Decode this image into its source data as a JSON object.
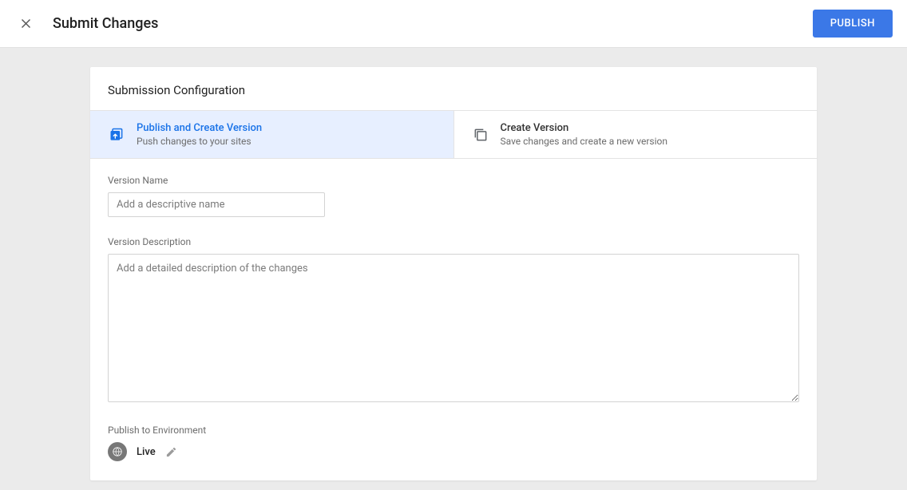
{
  "topbar": {
    "title": "Submit Changes",
    "publish_label": "PUBLISH"
  },
  "card": {
    "header": "Submission Configuration",
    "options": [
      {
        "title": "Publish and Create Version",
        "sub": "Push changes to your sites"
      },
      {
        "title": "Create Version",
        "sub": "Save changes and create a new version"
      }
    ],
    "version_name": {
      "label": "Version Name",
      "placeholder": "Add a descriptive name",
      "value": ""
    },
    "version_desc": {
      "label": "Version Description",
      "placeholder": "Add a detailed description of the changes",
      "value": ""
    },
    "env": {
      "label": "Publish to Environment",
      "name": "Live"
    }
  }
}
